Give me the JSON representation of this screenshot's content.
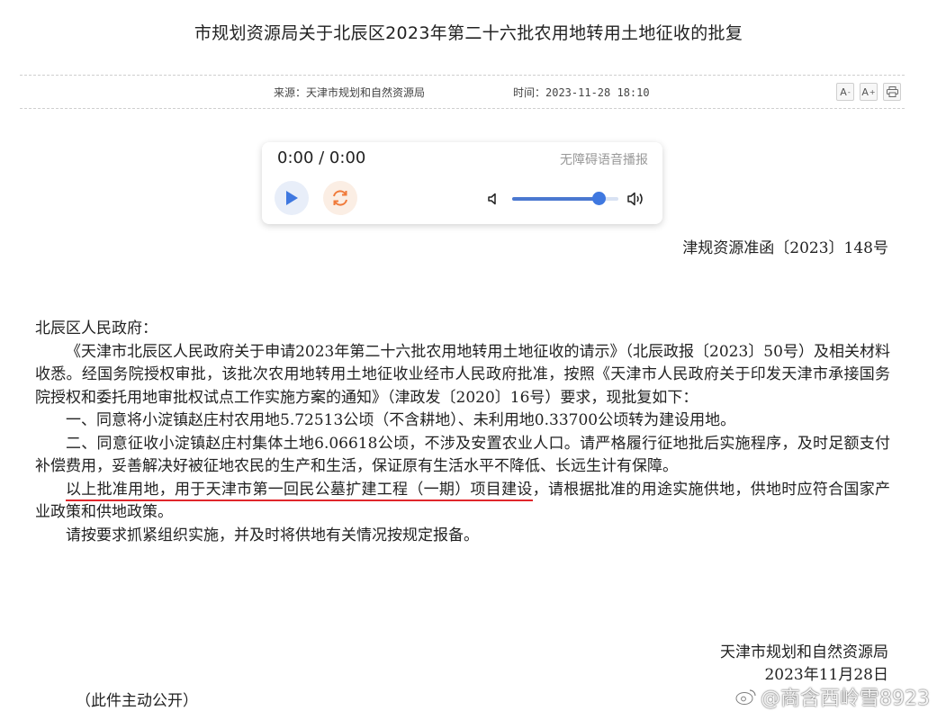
{
  "page_title": "市规划资源局关于北辰区2023年第二十六批农用地转用土地征收的批复",
  "meta": {
    "source": "来源：天津市规划和自然资源局",
    "time": "时间：2023-11-28 18:10",
    "font_decrease_label": "A-",
    "font_increase_label": "A+",
    "print_icon": "print-icon"
  },
  "player": {
    "time": "0:00 / 0:00",
    "label": "无障碍语音播报",
    "volume_percent": 81,
    "colors": {
      "accent": "#3f78e0",
      "replay": "#f07a3a"
    }
  },
  "doc_number": "津规资源准函〔2023〕148号",
  "body": {
    "salutation": "北辰区人民政府：",
    "p1": "《天津市北辰区人民政府关于申请2023年第二十六批农用地转用土地征收的请示》（北辰政报〔2023〕50号）及相关材料收悉。经国务院授权审批，该批次农用地转用土地征收业经市人民政府批准，按照《天津市人民政府关于印发天津市承接国务院授权和委托用地审批权试点工作实施方案的通知》（津政发〔2020〕16号）要求，现批复如下：",
    "p2": "一、同意将小淀镇赵庄村农用地5.72513公顷（不含耕地）、未利用地0.33700公顷转为建设用地。",
    "p3": "二、同意征收小淀镇赵庄村集体土地6.06618公顷，不涉及安置农业人口。请严格履行征地批后实施程序，及时足额支付补偿费用，妥善解决好被征地农民的生产和生活，保证原有生活水平不降低、长远生计有保障。",
    "p4_highlight": "以上批准用地，用于天津市第一回民公墓扩建工程（一期）项目建设",
    "p4_rest": "，请根据批准的用途实施供地，供地时应符合国家产业政策和供地政策。",
    "p5": "请按要求抓紧组织实施，并及时将供地有关情况按规定报备。"
  },
  "signature": {
    "org": "天津市规划和自然资源局",
    "date": "2023年11月28日"
  },
  "public_note": "（此件主动公开）",
  "watermark": "@商含西岭雪8923"
}
